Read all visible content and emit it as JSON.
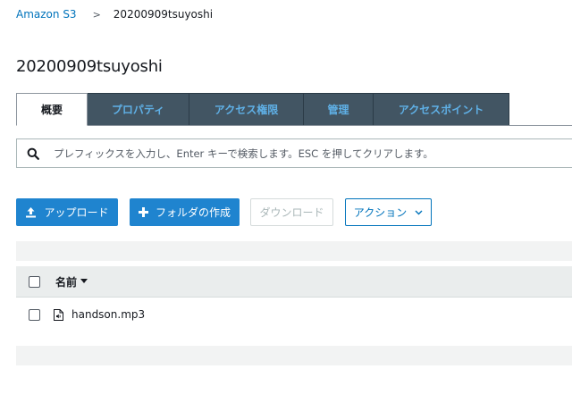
{
  "breadcrumb": {
    "root": "Amazon S3",
    "separator": ">",
    "current": "20200909tsuyoshi"
  },
  "page_title": "20200909tsuyoshi",
  "tabs": [
    {
      "label": "概要",
      "active": true
    },
    {
      "label": "プロパティ",
      "active": false
    },
    {
      "label": "アクセス権限",
      "active": false
    },
    {
      "label": "管理",
      "active": false
    },
    {
      "label": "アクセスポイント",
      "active": false
    }
  ],
  "search": {
    "placeholder": "プレフィックスを入力し、Enter キーで検索します。ESC を押してクリアします。",
    "value": ""
  },
  "toolbar": {
    "upload_label": "アップロード",
    "create_folder_label": "フォルダの作成",
    "download_label": "ダウンロード",
    "actions_label": "アクション"
  },
  "table": {
    "columns": {
      "name": "名前"
    },
    "rows": [
      {
        "name": "handson.mp3",
        "icon": "audio-file-icon"
      }
    ]
  },
  "colors": {
    "tab_bg": "#425563",
    "tab_text": "#5fb0e6",
    "primary": "#1f84cf",
    "link": "#0073bb"
  }
}
